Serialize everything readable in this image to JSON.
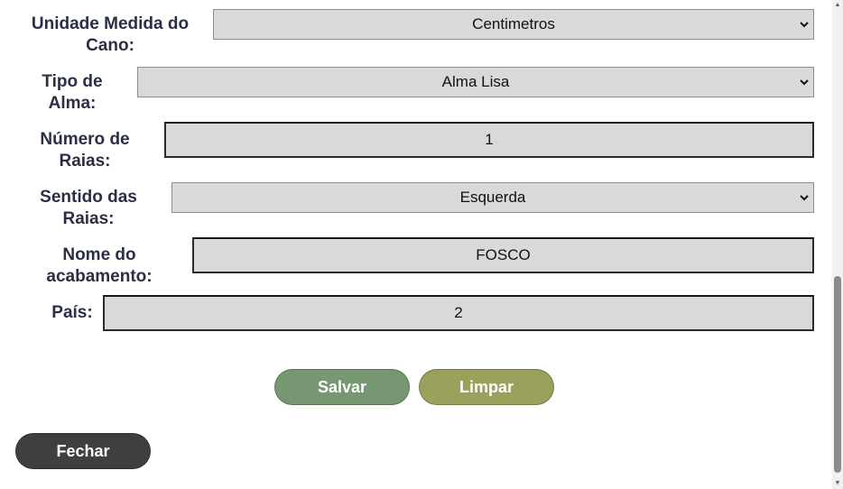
{
  "form": {
    "unidade": {
      "label": "Unidade Medida do Cano:",
      "value": "Centimetros"
    },
    "tipo_alma": {
      "label": "Tipo de Alma:",
      "value": "Alma Lisa"
    },
    "numero_raias": {
      "label": "Número de Raias:",
      "value": "1"
    },
    "sentido_raias": {
      "label": "Sentido das Raias:",
      "value": "Esquerda"
    },
    "nome_acabamento": {
      "label": "Nome do acabamento:",
      "value": "FOSCO"
    },
    "pais": {
      "label": "País:",
      "value": "2"
    }
  },
  "buttons": {
    "salvar": "Salvar",
    "limpar": "Limpar",
    "fechar": "Fechar"
  },
  "colors": {
    "label_text": "#2b2f45",
    "field_bg": "#d9d9d9",
    "salvar_bg": "#779672",
    "limpar_bg": "#9ca05d",
    "fechar_bg": "#3f3f3f"
  },
  "icons": {
    "select_arrow": "chevron-down-icon"
  }
}
